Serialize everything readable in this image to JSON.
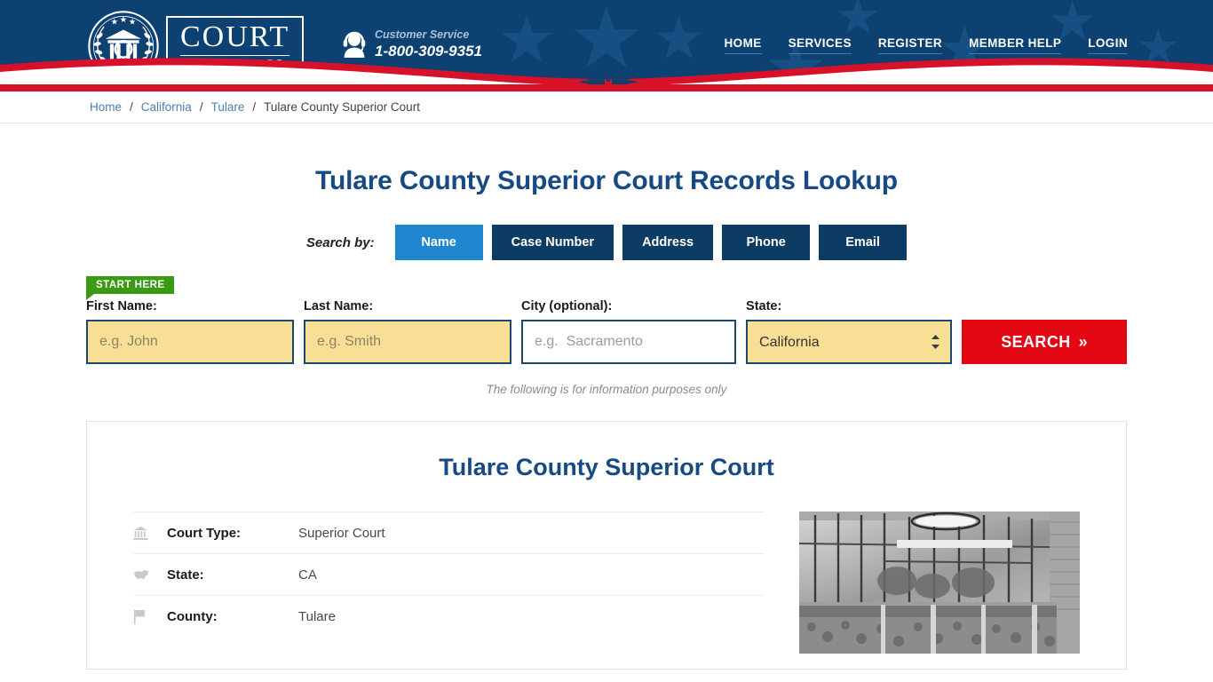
{
  "brand": {
    "name_main": "COURT",
    "name_sub": "CASE FINDER",
    "seal_icon": "courthouse-seal-icon"
  },
  "header": {
    "customer_service_label": "Customer Service",
    "customer_service_phone": "1-800-309-9351",
    "headset_icon": "headset-support-icon",
    "nav": [
      {
        "label": "HOME"
      },
      {
        "label": "SERVICES"
      },
      {
        "label": "REGISTER"
      },
      {
        "label": "MEMBER HELP"
      },
      {
        "label": "LOGIN"
      }
    ],
    "colors": {
      "navy": "#0d4172",
      "red": "#d8112a",
      "star_bg": "#164f81"
    }
  },
  "breadcrumb": {
    "items": [
      {
        "label": "Home",
        "link": true
      },
      {
        "label": "California",
        "link": true
      },
      {
        "label": "Tulare",
        "link": true
      },
      {
        "label": "Tulare County Superior Court",
        "link": false
      }
    ],
    "separator": "/"
  },
  "main": {
    "page_title": "Tulare County Superior Court Records Lookup",
    "search_by_label": "Search by:",
    "tabs": [
      {
        "label": "Name",
        "active": true
      },
      {
        "label": "Case Number",
        "active": false
      },
      {
        "label": "Address",
        "active": false
      },
      {
        "label": "Phone",
        "active": false
      },
      {
        "label": "Email",
        "active": false
      }
    ],
    "start_here_badge": "START HERE",
    "form": {
      "first_name_label": "First Name:",
      "first_name_placeholder": "e.g. John",
      "first_name_value": "",
      "last_name_label": "Last Name:",
      "last_name_placeholder": "e.g. Smith",
      "last_name_value": "",
      "city_label": "City (optional):",
      "city_placeholder": "e.g.  Sacramento",
      "city_value": "",
      "state_label": "State:",
      "state_selected": "California",
      "search_button": "SEARCH",
      "search_button_chevrons": "»"
    },
    "disclaimer": "The following is for information purposes only"
  },
  "court_card": {
    "title": "Tulare County Superior Court",
    "details": [
      {
        "icon": "bank-building-icon",
        "key": "Court Type:",
        "value": "Superior Court"
      },
      {
        "icon": "us-map-icon",
        "key": "State:",
        "value": "CA"
      },
      {
        "icon": "flag-icon",
        "key": "County:",
        "value": "Tulare"
      }
    ],
    "photo_alt": "courthouse-exterior-photo"
  },
  "colors": {
    "accent_blue": "#2186d0",
    "tab_navy": "#0c3b63",
    "title_blue": "#174a85",
    "field_yellow": "#f9df95",
    "field_border": "#17496f",
    "search_red": "#e30613",
    "badge_green": "#3a9a13"
  }
}
